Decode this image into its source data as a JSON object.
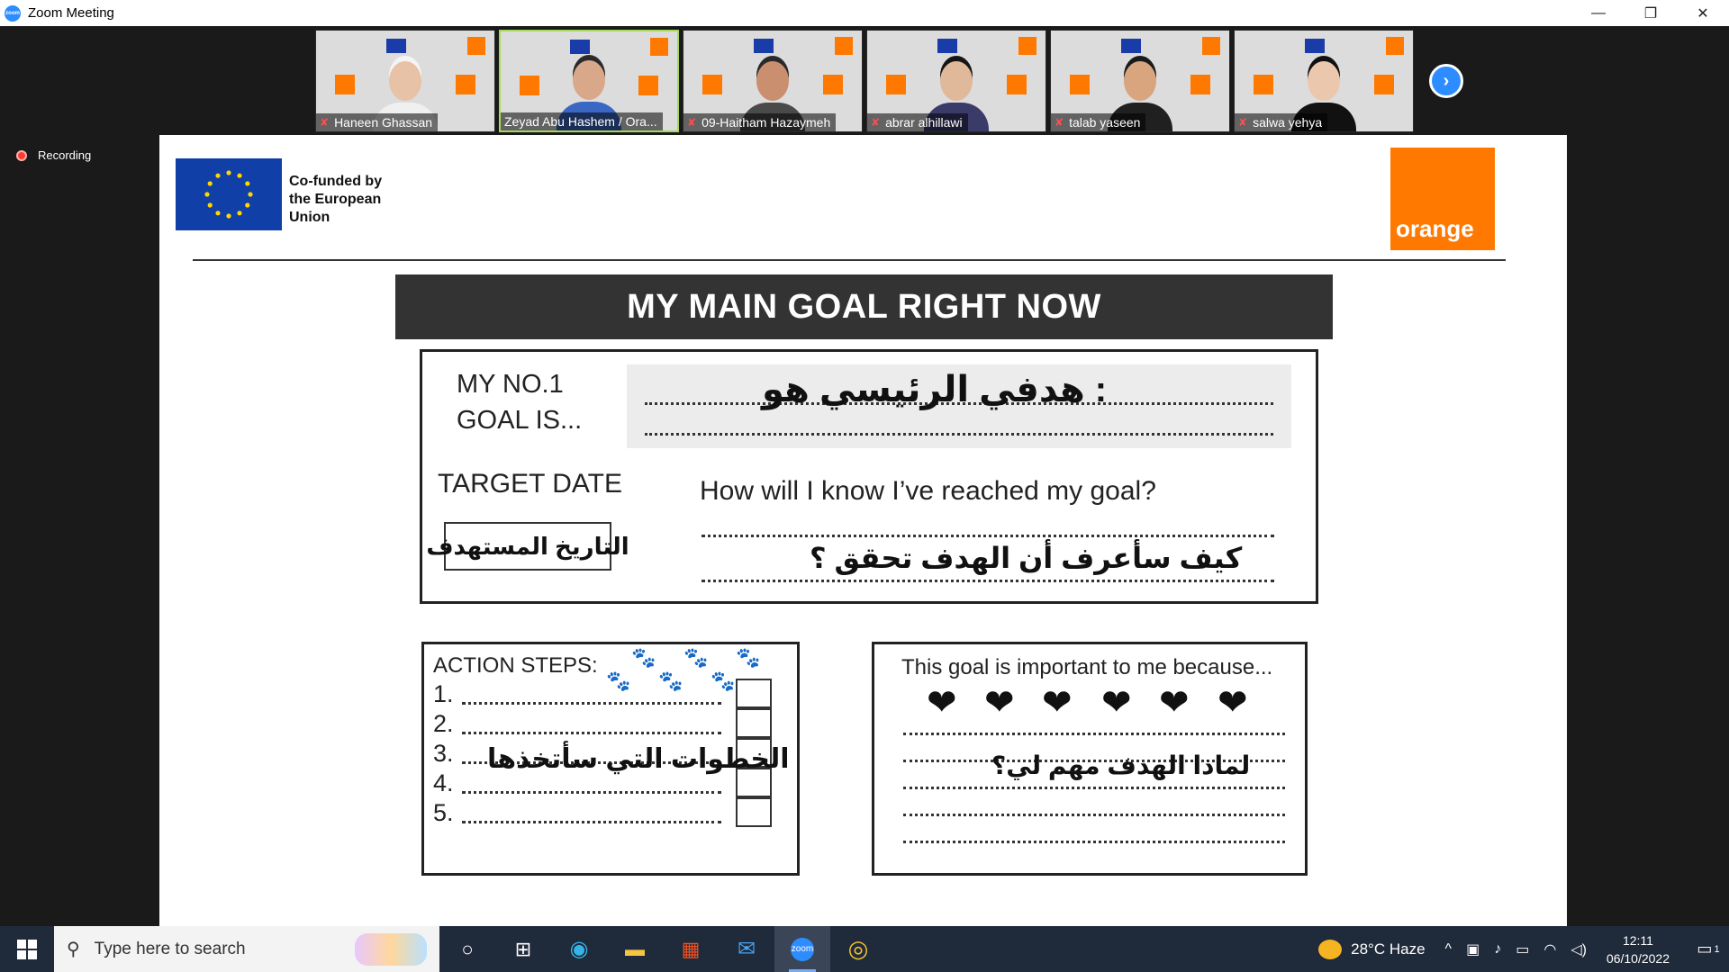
{
  "window": {
    "title": "Zoom Meeting",
    "minimize_glyph": "—",
    "restore_glyph": "❐",
    "close_glyph": "✕"
  },
  "participants": [
    {
      "name": "Haneen Ghassan",
      "muted": true,
      "skin": "#e7c2a6",
      "hair": "#f4f4f4",
      "shirt": "#f0f0f0"
    },
    {
      "name": "Zeyad Abu Hashem / Ora...",
      "muted": false,
      "skin": "#d9a88a",
      "hair": "#2a2a2a",
      "shirt": "#3a66c4"
    },
    {
      "name": "09-Haitham Hazaymeh",
      "muted": true,
      "skin": "#c98f6e",
      "hair": "#2a2a2a",
      "shirt": "#4a4a4a"
    },
    {
      "name": "abrar alhillawi",
      "muted": true,
      "skin": "#e0b89a",
      "hair": "#151515",
      "shirt": "#3b3b6a"
    },
    {
      "name": "talab yaseen",
      "muted": true,
      "skin": "#d8a57f",
      "hair": "#1a1a1a",
      "shirt": "#202020"
    },
    {
      "name": "salwa yehya",
      "muted": true,
      "skin": "#ebc7ad",
      "hair": "#111111",
      "shirt": "#111111"
    }
  ],
  "gallery_next_glyph": "›",
  "recording_label": "Recording",
  "slide": {
    "eu_text_1": "Co-funded by",
    "eu_text_2": "the European",
    "eu_text_3": "Union",
    "orange_logo": "orange",
    "title": "MY MAIN GOAL RIGHT NOW",
    "goal_label_1": "MY NO.1",
    "goal_label_2": "GOAL IS...",
    "goal_arabic": "هدفي الرئيسي هو :",
    "target_label": "TARGET DATE",
    "target_arabic": "التاريخ المستهدف",
    "reach_question": "How will I know I’ve reached my goal?",
    "reach_arabic": "كيف سأعرف أن الهدف تحقق ؟",
    "steps_title": "ACTION STEPS:",
    "steps": [
      "1.",
      "2.",
      "3.",
      "4.",
      "5."
    ],
    "steps_arabic": "الخطوات التي سأتخذها",
    "why_title": "This goal is important to me because...",
    "why_arabic": "لماذا الهدف مهم لي؟",
    "paw_glyph": "🐾",
    "heart_glyph": "❤"
  },
  "taskbar": {
    "search_placeholder": "Type here to search",
    "search_glyph": "⚲",
    "weather": "28°C  Haze",
    "time": "12:11",
    "date": "06/10/2022",
    "notif_count": "1",
    "apps": [
      {
        "name": "task-view",
        "glyph": "○"
      },
      {
        "name": "widgets",
        "glyph": "⊞"
      },
      {
        "name": "edge",
        "glyph": "◉"
      },
      {
        "name": "file-explorer",
        "glyph": "▬"
      },
      {
        "name": "microsoft-store",
        "glyph": "▦"
      },
      {
        "name": "mail",
        "glyph": "✉"
      },
      {
        "name": "zoom",
        "glyph": "zoom"
      },
      {
        "name": "chrome",
        "glyph": "◎"
      }
    ]
  },
  "colors": {
    "zoom_blue": "#2d8cff",
    "eu_blue": "#103fa8",
    "orange": "#ff7900",
    "taskbar": "#1f2a3a",
    "active_speaker": "#a8d85a"
  }
}
